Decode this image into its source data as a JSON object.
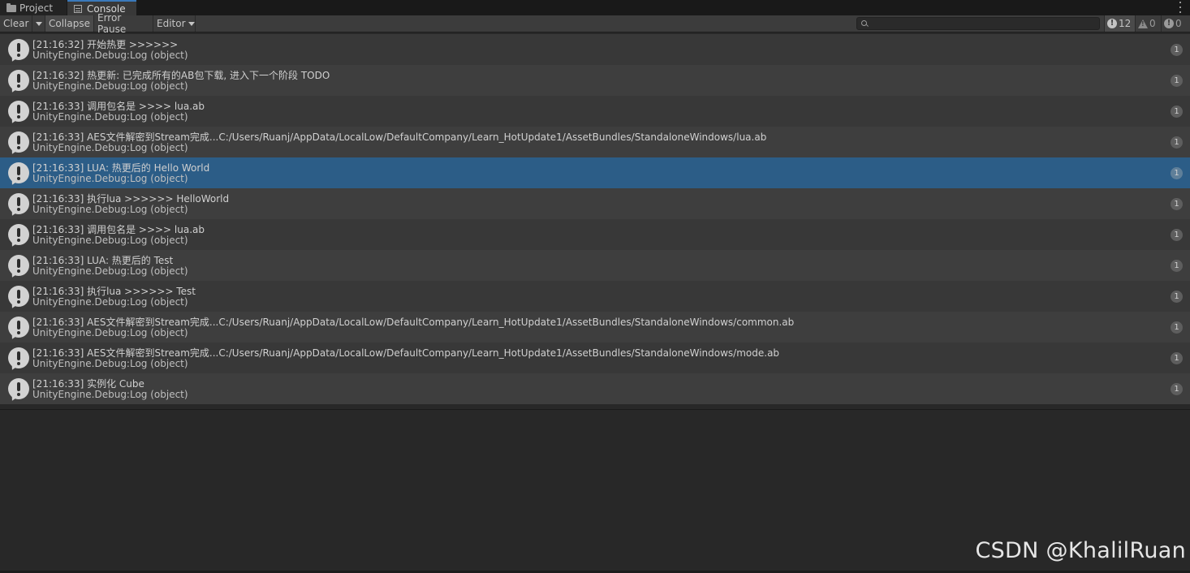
{
  "tabs": {
    "project": "Project",
    "console": "Console"
  },
  "toolbar": {
    "clear": "Clear",
    "collapse": "Collapse",
    "error_pause": "Error Pause",
    "editor": "Editor",
    "search_placeholder": "",
    "info_count": "12",
    "warning_count": "0",
    "error_count": "0"
  },
  "logs": [
    {
      "message": "[21:16:32] 开始热更 >>>>>>",
      "source": "UnityEngine.Debug:Log (object)",
      "count": "1"
    },
    {
      "message": "[21:16:32] 热更新: 已完成所有的AB包下载, 进入下一个阶段 TODO",
      "source": "UnityEngine.Debug:Log (object)",
      "count": "1"
    },
    {
      "message": "[21:16:33] 调用包名是 >>>> lua.ab",
      "source": "UnityEngine.Debug:Log (object)",
      "count": "1"
    },
    {
      "message": "[21:16:33] AES文件解密到Stream完成...C:/Users/Ruanj/AppData/LocalLow/DefaultCompany/Learn_HotUpdate1/AssetBundles/StandaloneWindows/lua.ab",
      "source": "UnityEngine.Debug:Log (object)",
      "count": "1"
    },
    {
      "message": "[21:16:33] LUA: 热更后的 Hello World",
      "source": "UnityEngine.Debug:Log (object)",
      "count": "1"
    },
    {
      "message": "[21:16:33] 执行lua >>>>>> HelloWorld",
      "source": "UnityEngine.Debug:Log (object)",
      "count": "1"
    },
    {
      "message": "[21:16:33] 调用包名是 >>>> lua.ab",
      "source": "UnityEngine.Debug:Log (object)",
      "count": "1"
    },
    {
      "message": "[21:16:33] LUA: 热更后的 Test",
      "source": "UnityEngine.Debug:Log (object)",
      "count": "1"
    },
    {
      "message": "[21:16:33] 执行lua >>>>>> Test",
      "source": "UnityEngine.Debug:Log (object)",
      "count": "1"
    },
    {
      "message": "[21:16:33] AES文件解密到Stream完成...C:/Users/Ruanj/AppData/LocalLow/DefaultCompany/Learn_HotUpdate1/AssetBundles/StandaloneWindows/common.ab",
      "source": "UnityEngine.Debug:Log (object)",
      "count": "1"
    },
    {
      "message": "[21:16:33] AES文件解密到Stream完成...C:/Users/Ruanj/AppData/LocalLow/DefaultCompany/Learn_HotUpdate1/AssetBundles/StandaloneWindows/mode.ab",
      "source": "UnityEngine.Debug:Log (object)",
      "count": "1"
    },
    {
      "message": "[21:16:33] 实例化 Cube",
      "source": "UnityEngine.Debug:Log (object)",
      "count": "1"
    }
  ],
  "selected_index": 4,
  "watermark": "CSDN @KhalilRuan",
  "icons": {
    "project_tab": "folder-icon",
    "console_tab": "console-icon",
    "menu": "kebab-menu-icon",
    "search": "search-icon",
    "log_row": "info-icon"
  }
}
